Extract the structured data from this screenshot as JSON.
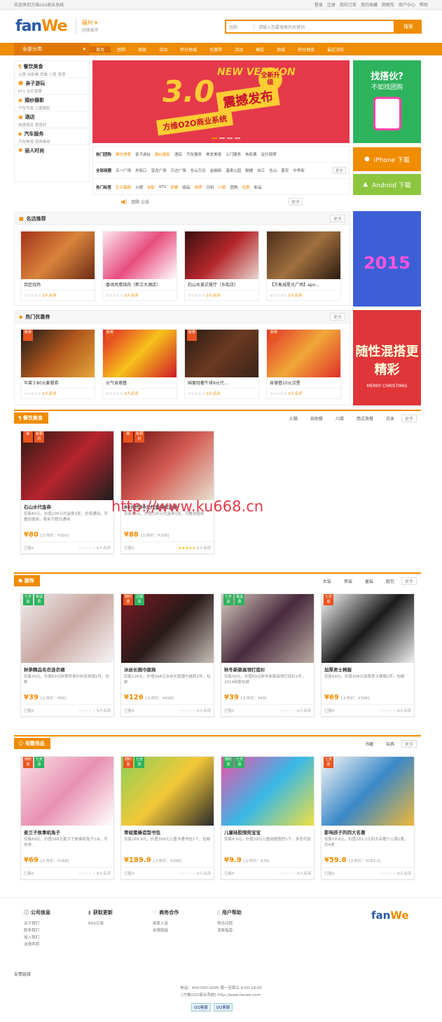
{
  "topbar": {
    "welcome": "欢迎来到方维o2o商业系统",
    "links": [
      "登录",
      "注册",
      "我的订单",
      "我的收藏",
      "购物车",
      "商户中心",
      "帮助"
    ]
  },
  "header": {
    "logo_a": "fan",
    "logo_b": "We",
    "city": "福州",
    "city_sub": "切换城市",
    "search_select": "团购",
    "search_placeholder": "请输入您要搜索的关键词",
    "search_btn": "搜索"
  },
  "nav": {
    "category": "全部分类",
    "items": [
      "首页",
      "团购",
      "商家",
      "活动",
      "积分商城",
      "优惠券",
      "活动",
      "抽奖",
      "商城",
      "积分抽奖",
      "最近浏览"
    ]
  },
  "side": [
    {
      "title": "餐饮美食",
      "sub": "火锅 自助餐 西餐 川菜 粤菜"
    },
    {
      "title": "亲子游玩",
      "sub": "KTV 足疗按摩"
    },
    {
      "title": "婚纱摄影",
      "sub": "个性写真 儿童摄影"
    },
    {
      "title": "酒店",
      "sub": "快捷酒店 度假村"
    },
    {
      "title": "汽车服务",
      "sub": "汽车美容 保养维修"
    },
    {
      "title": "丽人时尚",
      "sub": ""
    }
  ],
  "banner": {
    "big": "3.0",
    "new": "NEW VERSION",
    "headline": "震撼发布",
    "badge": "全新升级",
    "sub": "方维O2O商业系统"
  },
  "filters": {
    "row1": {
      "h": "热门团购",
      "items": [
        "餐饮美食",
        "亲子游玩",
        "婚纱摄影",
        "酒店",
        "汽车服务",
        "美发美容",
        "上门服务",
        "电影票",
        "足疗按摩"
      ]
    },
    "row2": {
      "h": "全部商圈",
      "items": [
        "五一广场",
        "东街口",
        "宝龙广场",
        "万达广场",
        "仓山万达",
        "金融街",
        "温泉公园",
        "鼓楼",
        "台江",
        "仓山",
        "晋安",
        "中亭街"
      ]
    },
    "row3": {
      "h": "热门标签",
      "items": [
        "生日蛋糕",
        "火锅",
        "自助",
        "KTV",
        "西餐",
        "甜品",
        "烧烤",
        "日料",
        "川菜",
        "团购",
        "优惠",
        "新品"
      ]
    },
    "more": "更多"
  },
  "announcement": {
    "text": "团购 公告",
    "more": "更多"
  },
  "right": {
    "t1a": "找搭伙?",
    "t1b": "不如找团购",
    "iphone": "iPhone 下载",
    "android": "Android 下载",
    "y2015": "2015",
    "christmas": "随性混搭更精彩",
    "merry": "MERRY CHRISTMAS"
  },
  "shops": {
    "title": "名店推荐",
    "more": "更多",
    "items": [
      {
        "name": "百匠烧鸡",
        "rating": "0人点评"
      },
      {
        "name": "香颂风情烧肉（新江大酒店）",
        "rating": "0人点评"
      },
      {
        "name": "石山水美式餐厅（东街店）",
        "rating": "0人点评"
      },
      {
        "name": "【万象城星光广场】apo...",
        "rating": "0人点评"
      }
    ]
  },
  "coupons": {
    "title": "热门优惠券",
    "more": "更多",
    "items": [
      {
        "name": "华莱士80元套餐券",
        "rating": "0人点评",
        "tag": "新券"
      },
      {
        "name": "元气肯德基",
        "rating": "0人点评",
        "tag": "新券"
      },
      {
        "name": "国宴轻奢牛排9元代...",
        "rating": "0人点评",
        "tag": "新券"
      },
      {
        "name": "肯德基10元汉堡",
        "rating": "0人点评",
        "tag": "新券"
      }
    ]
  },
  "food": {
    "title": "餐饮美食",
    "filters": [
      "火锅",
      "自助餐",
      "川菜",
      "西式快餐",
      "日本"
    ],
    "more": "更多",
    "items": [
      {
        "name": "石山水代金券",
        "desc": "仅售80元，价值100元代金券1张，全场通用，可叠加使用，周末节假日通用",
        "price": "¥80",
        "orig": "[上市价：¥100]",
        "sold": "已售0",
        "rating": "0人点评",
        "tags": [
          "新",
          "免预约"
        ]
      },
      {
        "name": "88元代88元代金券代金券",
        "desc": "仅售88元，价值100元代金券1张，可叠加使用",
        "price": "¥88",
        "orig": "[上市价：¥158]",
        "sold": "已售0",
        "rating": "0人点评",
        "tags": [
          "新",
          "免预约"
        ]
      }
    ]
  },
  "clothes": {
    "title": "服饰",
    "filters": [
      "女装",
      "男装",
      "童装",
      "鞋包"
    ],
    "more": "更多",
    "items": [
      {
        "name": "秋季精品毛衣连衣裙",
        "desc": "仅售39元，价值69元秋季修身针织连衣裙1件，包邮",
        "price": "¥39",
        "orig": "[上市价：¥69]",
        "sold": "已售0",
        "rating": "0人点评",
        "tags": [
          "七天退",
          "免运费"
        ]
      },
      {
        "name": "冰丝长围巾披肩",
        "desc": "仅售126元，价值698元冰丝长款围巾披肩1件，包邮",
        "price": "¥126",
        "orig": "[上市价：¥698]",
        "sold": "已售0",
        "rating": "0人点评",
        "tags": [
          "随时退",
          "过期退"
        ]
      },
      {
        "name": "秋冬新款高领打底衫",
        "desc": "仅售39元，价值69元秋冬新款高领打底衫1件，2014新款包邮",
        "price": "¥39",
        "orig": "[上市价：¥69]",
        "sold": "已售0",
        "rating": "0人点评",
        "tags": [
          "七天退",
          "免运费"
        ]
      },
      {
        "name": "加厚男士棉服",
        "desc": "仅售69元，价值398元加厚男士棉服1件，包邮",
        "price": "¥69",
        "orig": "[上市价：¥398]",
        "sold": "已售0",
        "rating": "0人点评",
        "tags": [
          "七天退"
        ]
      }
    ]
  },
  "baby": {
    "title": "母婴用品",
    "filters": [
      "书籍",
      "玩具"
    ],
    "more": "更多",
    "items": [
      {
        "name": "麦兰子故事机兔子",
        "desc": "仅售69元，价值268元麦兰子故事机兔子1台，可充电",
        "price": "¥69",
        "orig": "[上市价：¥268]",
        "sold": "已售0",
        "rating": "0人点评",
        "tags": [
          "随时退",
          "七天退"
        ]
      },
      {
        "name": "青蛙蜜蜂造型书包",
        "desc": "仅售189.9元，价值399元儿童卡通书包1个，包邮",
        "price": "¥189.9",
        "orig": "[上市价：¥399]",
        "sold": "已售0",
        "rating": "0人点评",
        "tags": [
          "随时退",
          "七天退"
        ]
      },
      {
        "name": "儿童硅胶围兜宝宝",
        "desc": "仅售9.9元，价值29元儿童硅胶围兜1个，多色可选",
        "price": "¥9.9",
        "orig": "[上市价：¥29]",
        "sold": "已售0",
        "rating": "0人点评",
        "tags": [
          "随时退",
          "七天退"
        ]
      },
      {
        "name": "影响孩子的四大名著",
        "desc": "仅售59.8元，价值183.2元四大名著少儿版1套，共4册",
        "price": "¥59.8",
        "orig": "[上市价：¥183.2]",
        "sold": "已售0",
        "rating": "0人点评",
        "tags": [
          "七天退"
        ]
      }
    ]
  },
  "watermark": "http://www.ku668.cn",
  "footer": {
    "cols": [
      {
        "h": "公司信息",
        "links": [
          "关于我们",
          "联系我们",
          "加入我们",
          "法律声明"
        ]
      },
      {
        "h": "获取更新",
        "links": [
          "RSS订阅"
        ]
      },
      {
        "h": "商务合作",
        "links": [
          "商家入驻",
          "友情链接"
        ]
      },
      {
        "h": "用户帮助",
        "links": [
          "常见问题",
          "消费指南"
        ]
      }
    ],
    "logo_a": "fan",
    "logo_b": "We",
    "links": "友情链接",
    "copy1": "电话：400-000-0000 周一至周五 9:00-18:00",
    "copy2": "[方维O2O商业系统] http://www.fanwe.com",
    "qq1": "QQ客服",
    "qq2": "QQ客服"
  }
}
